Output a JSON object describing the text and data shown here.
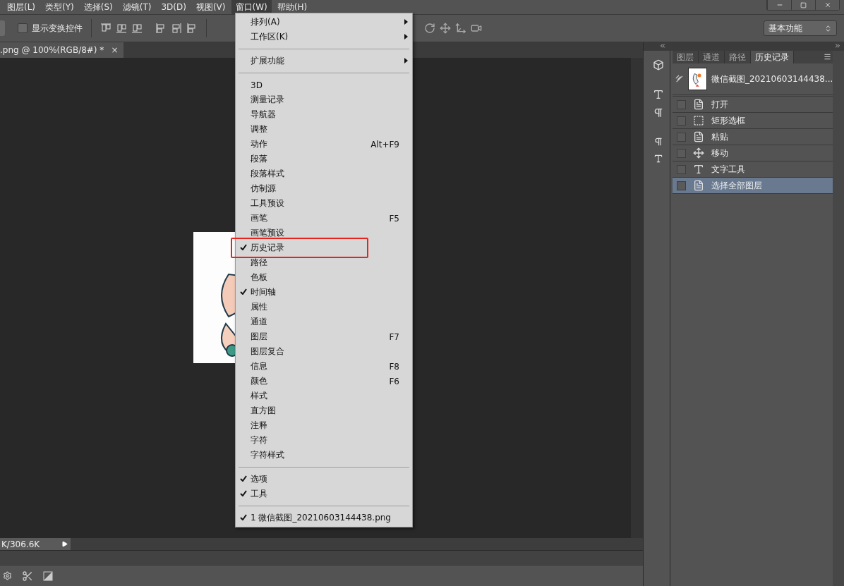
{
  "menubar": [
    {
      "label": "图层(L)",
      "selected": false
    },
    {
      "label": "类型(Y)",
      "selected": false
    },
    {
      "label": "选择(S)",
      "selected": false
    },
    {
      "label": "滤镜(T)",
      "selected": false
    },
    {
      "label": "3D(D)",
      "selected": false
    },
    {
      "label": "视图(V)",
      "selected": false
    },
    {
      "label": "窗口(W)",
      "selected": true
    },
    {
      "label": "帮助(H)",
      "selected": false
    }
  ],
  "options_bar": {
    "checkbox": {
      "label": "显示变换控件",
      "checked": false
    },
    "workspace": "基本功能"
  },
  "document_tab": {
    "title": ".png @ 100%(RGB/8#) *",
    "close": "×"
  },
  "status_bar": {
    "text": "K/306.6K"
  },
  "window_menu": {
    "sections": [
      [
        {
          "label": "排列(A)",
          "checked": false,
          "submenu": true,
          "highlighted": false
        },
        {
          "label": "工作区(K)",
          "checked": false,
          "submenu": true,
          "highlighted": false
        }
      ],
      [
        {
          "label": "扩展功能",
          "checked": false,
          "submenu": true,
          "highlighted": false
        }
      ],
      [
        {
          "label": "3D",
          "checked": false,
          "highlighted": false
        },
        {
          "label": "测量记录",
          "checked": false,
          "highlighted": false
        },
        {
          "label": "导航器",
          "checked": false,
          "highlighted": false
        },
        {
          "label": "调整",
          "checked": false,
          "highlighted": false
        },
        {
          "label": "动作",
          "checked": false,
          "shortcut": "Alt+F9",
          "highlighted": false
        },
        {
          "label": "段落",
          "checked": false,
          "highlighted": false
        },
        {
          "label": "段落样式",
          "checked": false,
          "highlighted": false
        },
        {
          "label": "仿制源",
          "checked": false,
          "highlighted": false
        },
        {
          "label": "工具预设",
          "checked": false,
          "highlighted": false
        },
        {
          "label": "画笔",
          "checked": false,
          "shortcut": "F5",
          "highlighted": false
        },
        {
          "label": "画笔预设",
          "checked": false,
          "highlighted": false
        },
        {
          "label": "历史记录",
          "checked": true,
          "highlighted": true
        },
        {
          "label": "路径",
          "checked": false,
          "highlighted": false
        },
        {
          "label": "色板",
          "checked": false,
          "highlighted": false
        },
        {
          "label": "时间轴",
          "checked": true,
          "highlighted": false
        },
        {
          "label": "属性",
          "checked": false,
          "highlighted": false
        },
        {
          "label": "通道",
          "checked": false,
          "highlighted": false
        },
        {
          "label": "图层",
          "checked": false,
          "shortcut": "F7",
          "highlighted": false
        },
        {
          "label": "图层复合",
          "checked": false,
          "highlighted": false
        },
        {
          "label": "信息",
          "checked": false,
          "shortcut": "F8",
          "highlighted": false
        },
        {
          "label": "颜色",
          "checked": false,
          "shortcut": "F6",
          "highlighted": false
        },
        {
          "label": "样式",
          "checked": false,
          "highlighted": false
        },
        {
          "label": "直方图",
          "checked": false,
          "highlighted": false
        },
        {
          "label": "注释",
          "checked": false,
          "highlighted": false
        },
        {
          "label": "字符",
          "checked": false,
          "highlighted": false
        },
        {
          "label": "字符样式",
          "checked": false,
          "highlighted": false
        }
      ],
      [
        {
          "label": "选项",
          "checked": true,
          "highlighted": false
        },
        {
          "label": "工具",
          "checked": true,
          "highlighted": false
        }
      ],
      [
        {
          "label": "1 微信截图_20210603144438.png",
          "checked": true,
          "highlighted": false
        }
      ]
    ]
  },
  "history_panel": {
    "tabs": [
      {
        "label": "图层",
        "selected": false
      },
      {
        "label": "通道",
        "selected": false
      },
      {
        "label": "路径",
        "selected": false
      },
      {
        "label": "历史记录",
        "selected": true
      }
    ],
    "snapshot": "微信截图_20210603144438...",
    "steps": [
      {
        "label": "打开",
        "kind": "document",
        "selected": false
      },
      {
        "label": "矩形选框",
        "kind": "marquee",
        "selected": false
      },
      {
        "label": "粘贴",
        "kind": "document",
        "selected": false
      },
      {
        "label": "移动",
        "kind": "move",
        "selected": false
      },
      {
        "label": "文字工具",
        "kind": "text",
        "selected": false
      },
      {
        "label": "选择全部图层",
        "kind": "document",
        "selected": true
      }
    ]
  }
}
